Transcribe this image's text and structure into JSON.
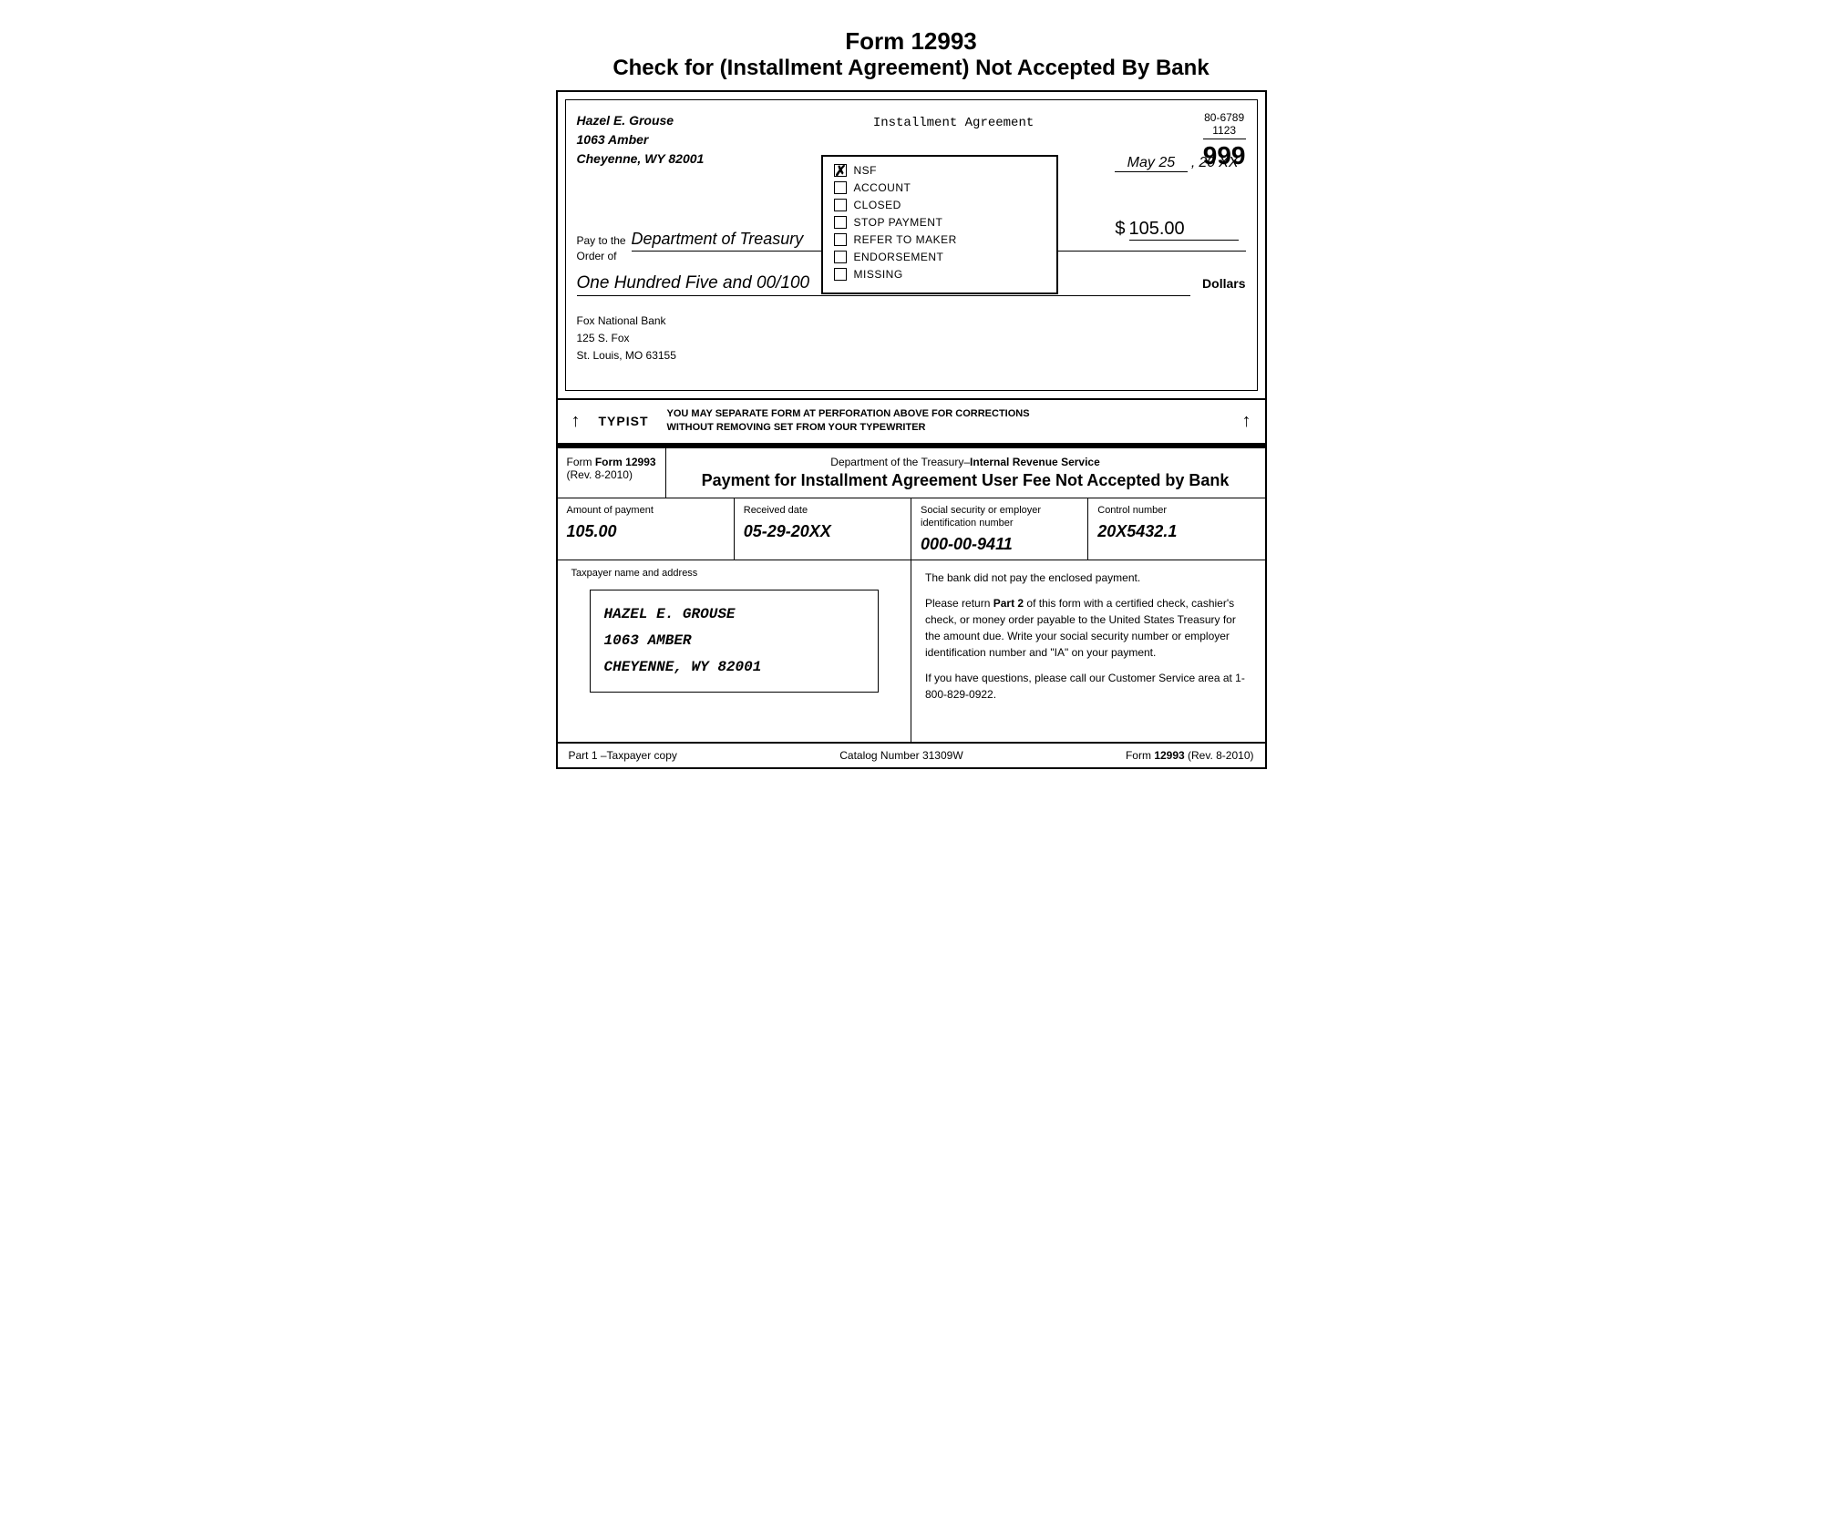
{
  "page": {
    "form_number": "Form 12993",
    "form_subtitle": "Check for (Installment Agreement) Not Accepted By Bank"
  },
  "check": {
    "name": "Hazel E. Grouse",
    "address1": "1063 Amber",
    "address2": "Cheyenne, WY  82001",
    "center_label": "Installment Agreement",
    "routing_number": "80-6789",
    "sub_routing": "1123",
    "check_number": "999",
    "date_month_day": "May 25",
    "date_year_prefix": "20",
    "date_year_suffix": "XX",
    "pay_to_label1": "Pay to the",
    "pay_to_label2": "Order of",
    "payee": "Department of Treasury",
    "dollar_sign": "$",
    "amount": "105.00",
    "written_amount": "One Hundred Five and 00/100",
    "dollars_label": "Dollars",
    "bank_name": "Fox National Bank",
    "bank_address1": "125 S. Fox",
    "bank_address2": "St. Louis, MO  63155"
  },
  "nsf_box": {
    "items": [
      {
        "id": "nsf",
        "label": "NSF",
        "checked": true
      },
      {
        "id": "account",
        "label": "ACCOUNT",
        "checked": false
      },
      {
        "id": "closed",
        "label": "CLOSED",
        "checked": false
      },
      {
        "id": "stop_payment",
        "label": "STOP PAYMENT",
        "checked": false
      },
      {
        "id": "refer_to_maker",
        "label": "REFER TO MAKER",
        "checked": false
      },
      {
        "id": "endorsement",
        "label": "ENDORSEMENT",
        "checked": false
      },
      {
        "id": "missing",
        "label": "MISSING",
        "checked": false
      }
    ]
  },
  "typist_section": {
    "arrow_up": "↑",
    "label": "TYPIST",
    "note_line1": "YOU MAY SEPARATE FORM AT PERFORATION ABOVE FOR CORRECTIONS",
    "note_line2": "WITHOUT REMOVING SET FROM YOUR TYPEWRITER",
    "arrow_up2": "↑"
  },
  "lower_form": {
    "form_number": "Form 12993",
    "rev": "(Rev. 8-2010)",
    "dept_line": "Department of the Treasury–Internal Revenue Service",
    "payment_title": "Payment for Installment Agreement User Fee Not Accepted by Bank",
    "fields": [
      {
        "label": "Amount of payment",
        "value": "105.00"
      },
      {
        "label": "Received date",
        "value": "05-29-20XX"
      },
      {
        "label": "Social security or employer\nidentification number",
        "value": "000-00-9411"
      },
      {
        "label": "Control number",
        "value": "20X5432.1"
      }
    ],
    "taxpayer_label": "Taxpayer name and address",
    "taxpayer_name": "HAZEL  E. GROUSE",
    "taxpayer_address1": "1063 AMBER",
    "taxpayer_address2": "CHEYENNE, WY  82001",
    "instructions_p1": "The bank did not pay the enclosed payment.",
    "instructions_p2_pre": "Please return ",
    "instructions_p2_bold": "Part 2",
    "instructions_p2_post": " of this form with a certified check, cashier's check, or money order payable to the United States Treasury for the amount due. Write your social security number or employer identification number and \"IA\" on your payment.",
    "instructions_p3": "If you have questions, please call our Customer Service area at 1-800-829-0922.",
    "footer_left": "Part 1 –Taxpayer copy",
    "footer_center": "Catalog Number 31309W",
    "footer_right_pre": "Form ",
    "footer_right_form": "12993",
    "footer_right_post": " (Rev. 8-2010)"
  }
}
